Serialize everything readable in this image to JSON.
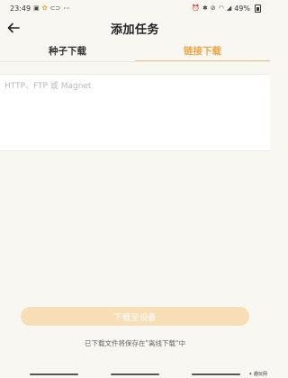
{
  "status_bar": {
    "time": "23:49",
    "dots": "···",
    "battery": "49%"
  },
  "header": {
    "title": "添加任务",
    "back_icon": "arrow-left-icon"
  },
  "tabs": [
    {
      "label": "种子下载",
      "active": false
    },
    {
      "label": "链接下载",
      "active": true
    }
  ],
  "url_input": {
    "placeholder": "HTTP、FTP 或 Magnet",
    "value": ""
  },
  "download_button": {
    "label": "下载至设备",
    "enabled": false
  },
  "save_note": "已下载文件将保存在\"离线下载\"中",
  "watermark": "✦ 趣玩网",
  "colors": {
    "accent": "#e9a64c",
    "button_disabled": "#f7deb6",
    "background": "#f8f7f1"
  }
}
